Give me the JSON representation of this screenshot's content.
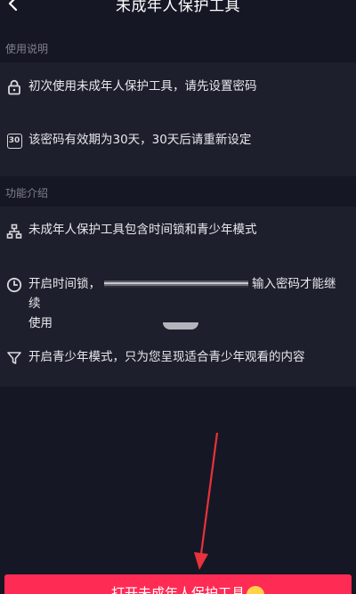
{
  "header": {
    "title": "未成年人保护工具",
    "back_icon": "chevron-left-icon"
  },
  "sections": [
    {
      "label": "使用说明",
      "items": [
        {
          "icon": "lock-icon",
          "text": "初次使用未成年人保护工具，请先设置密码"
        },
        {
          "icon": "calendar-30-icon",
          "icon_text": "30",
          "text": "该密码有效期为30天，30天后请重新设定"
        }
      ]
    },
    {
      "label": "功能介绍",
      "items": [
        {
          "icon": "hierarchy-icon",
          "text": "未成年人保护工具包含时间锁和青少年模式"
        },
        {
          "icon": "clock-icon",
          "text_start": "开启时间锁，",
          "text_end": "输入密码才能继续",
          "text_line2": "使用"
        },
        {
          "icon": "filter-icon",
          "text": "开启青少年模式，只为您呈现适合青少年观看的内容"
        }
      ]
    }
  ],
  "bottom_button": {
    "label": "打开未成年人保护工具"
  },
  "colors": {
    "background": "#161724",
    "card": "#1e1f2c",
    "accent": "#fe2c55",
    "annotation_arrow": "#e8323c"
  }
}
